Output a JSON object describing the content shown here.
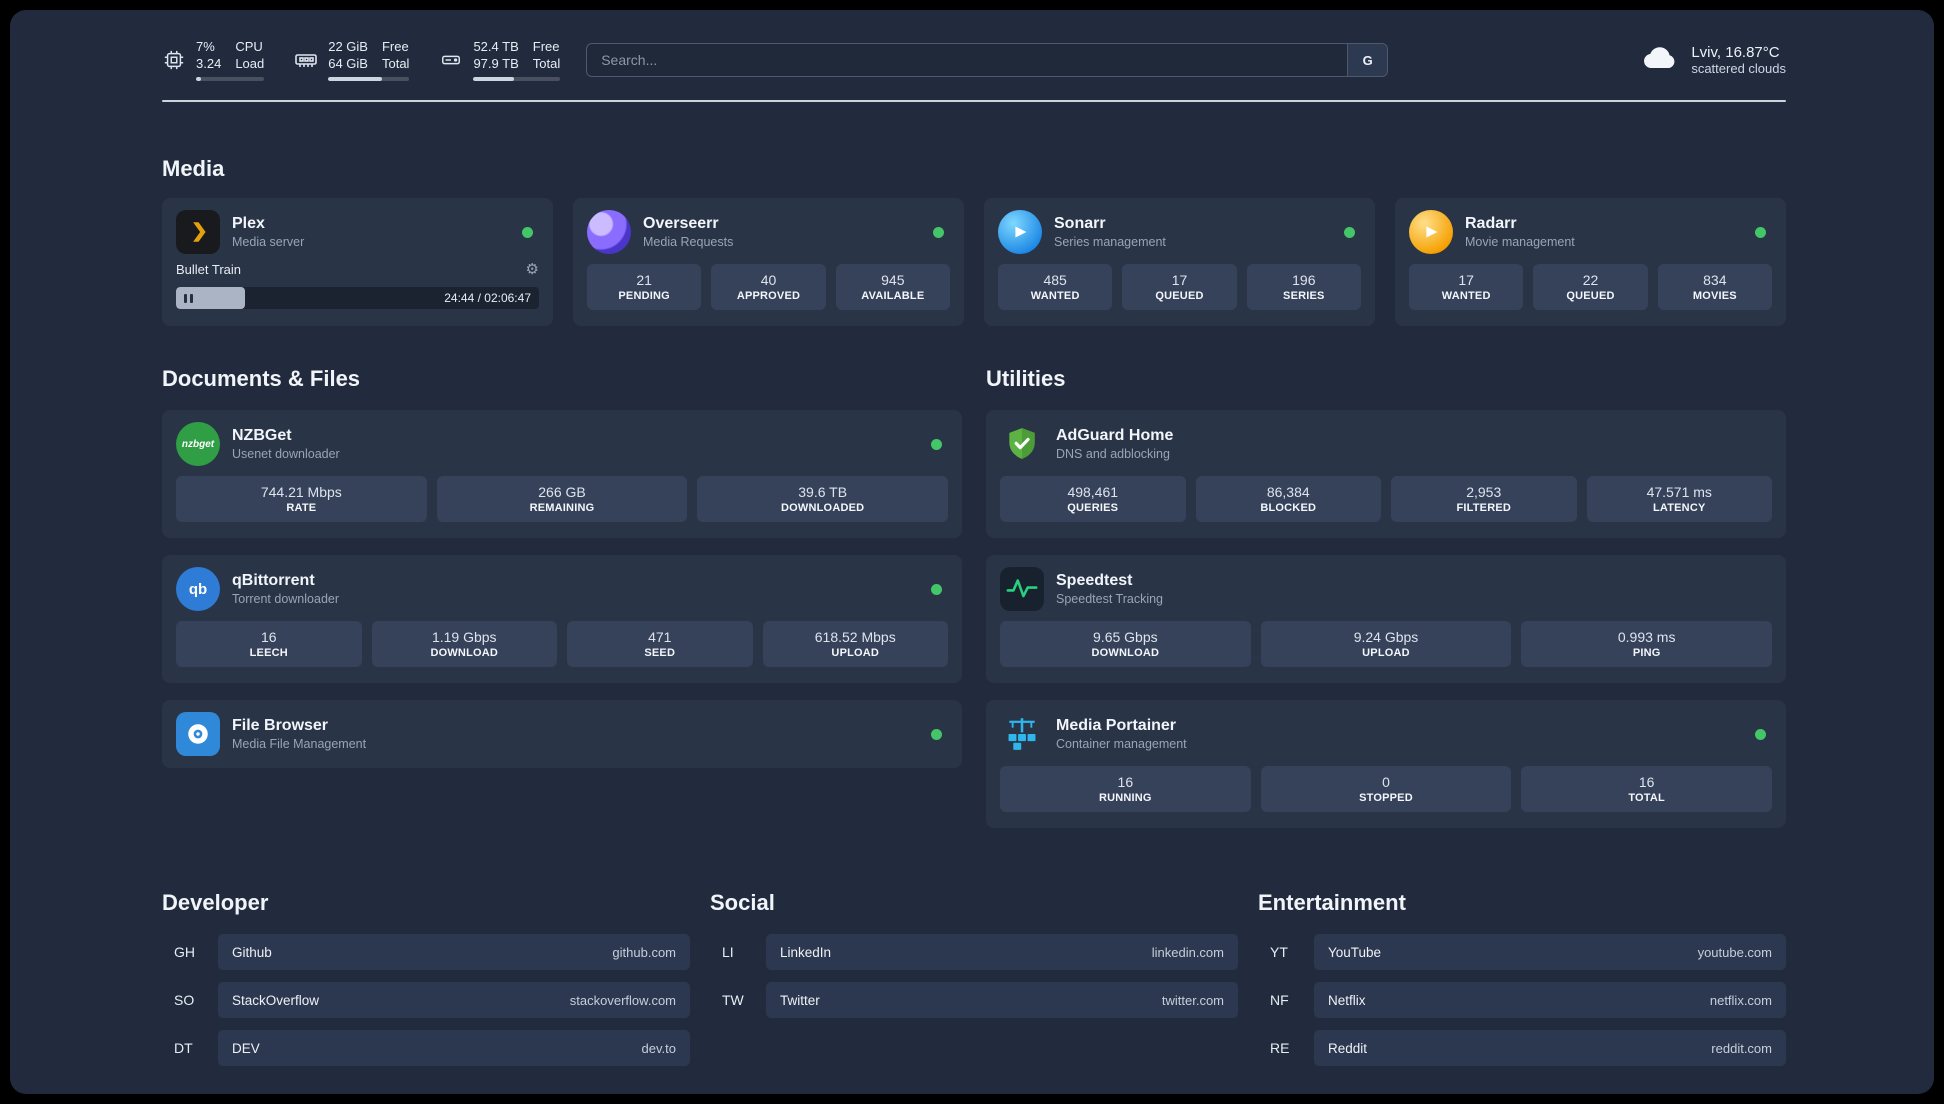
{
  "topbar": {
    "cpu": {
      "percent": "7%",
      "load": "3.24",
      "label_top": "CPU",
      "label_bottom": "Load",
      "fill_percent": 7
    },
    "memory": {
      "free": "22 GiB",
      "total": "64 GiB",
      "label_top": "Free",
      "label_bottom": "Total",
      "fill_percent": 66
    },
    "disk": {
      "free": "52.4 TB",
      "total": "97.9 TB",
      "label_top": "Free",
      "label_bottom": "Total",
      "fill_percent": 47
    },
    "search": {
      "placeholder": "Search...",
      "engine_label": "G"
    },
    "weather": {
      "location_temp": "Lviv, 16.87°C",
      "condition": "scattered clouds"
    }
  },
  "media": {
    "title": "Media",
    "plex": {
      "name": "Plex",
      "subtitle": "Media server",
      "now_playing": "Bullet Train",
      "time": "24:44 / 02:06:47",
      "progress_percent": 19
    },
    "overseerr": {
      "name": "Overseerr",
      "subtitle": "Media Requests",
      "stats": [
        {
          "value": "21",
          "label": "PENDING"
        },
        {
          "value": "40",
          "label": "APPROVED"
        },
        {
          "value": "945",
          "label": "AVAILABLE"
        }
      ]
    },
    "sonarr": {
      "name": "Sonarr",
      "subtitle": "Series management",
      "stats": [
        {
          "value": "485",
          "label": "WANTED"
        },
        {
          "value": "17",
          "label": "QUEUED"
        },
        {
          "value": "196",
          "label": "SERIES"
        }
      ]
    },
    "radarr": {
      "name": "Radarr",
      "subtitle": "Movie management",
      "stats": [
        {
          "value": "17",
          "label": "WANTED"
        },
        {
          "value": "22",
          "label": "QUEUED"
        },
        {
          "value": "834",
          "label": "MOVIES"
        }
      ]
    }
  },
  "documents": {
    "title": "Documents & Files",
    "nzbget": {
      "name": "NZBGet",
      "subtitle": "Usenet downloader",
      "icon_text": "nzbget",
      "stats": [
        {
          "value": "744.21 Mbps",
          "label": "RATE"
        },
        {
          "value": "266 GB",
          "label": "REMAINING"
        },
        {
          "value": "39.6 TB",
          "label": "DOWNLOADED"
        }
      ]
    },
    "qbittorrent": {
      "name": "qBittorrent",
      "subtitle": "Torrent downloader",
      "icon_text": "qb",
      "stats": [
        {
          "value": "16",
          "label": "LEECH"
        },
        {
          "value": "1.19 Gbps",
          "label": "DOWNLOAD"
        },
        {
          "value": "471",
          "label": "SEED"
        },
        {
          "value": "618.52 Mbps",
          "label": "UPLOAD"
        }
      ]
    },
    "filebrowser": {
      "name": "File Browser",
      "subtitle": "Media File Management"
    }
  },
  "utilities": {
    "title": "Utilities",
    "adguard": {
      "name": "AdGuard Home",
      "subtitle": "DNS and adblocking",
      "stats": [
        {
          "value": "498,461",
          "label": "QUERIES"
        },
        {
          "value": "86,384",
          "label": "BLOCKED"
        },
        {
          "value": "2,953",
          "label": "FILTERED"
        },
        {
          "value": "47.571 ms",
          "label": "LATENCY"
        }
      ]
    },
    "speedtest": {
      "name": "Speedtest",
      "subtitle": "Speedtest Tracking",
      "stats": [
        {
          "value": "9.65 Gbps",
          "label": "DOWNLOAD"
        },
        {
          "value": "9.24 Gbps",
          "label": "UPLOAD"
        },
        {
          "value": "0.993 ms",
          "label": "PING"
        }
      ]
    },
    "portainer": {
      "name": "Media Portainer",
      "subtitle": "Container management",
      "stats": [
        {
          "value": "16",
          "label": "RUNNING"
        },
        {
          "value": "0",
          "label": "STOPPED"
        },
        {
          "value": "16",
          "label": "TOTAL"
        }
      ]
    }
  },
  "bookmarks": {
    "developer": {
      "title": "Developer",
      "items": [
        {
          "abbr": "GH",
          "name": "Github",
          "url": "github.com"
        },
        {
          "abbr": "SO",
          "name": "StackOverflow",
          "url": "stackoverflow.com"
        },
        {
          "abbr": "DT",
          "name": "DEV",
          "url": "dev.to"
        }
      ]
    },
    "social": {
      "title": "Social",
      "items": [
        {
          "abbr": "LI",
          "name": "LinkedIn",
          "url": "linkedin.com"
        },
        {
          "abbr": "TW",
          "name": "Twitter",
          "url": "twitter.com"
        }
      ]
    },
    "entertainment": {
      "title": "Entertainment",
      "items": [
        {
          "abbr": "YT",
          "name": "YouTube",
          "url": "youtube.com"
        },
        {
          "abbr": "NF",
          "name": "Netflix",
          "url": "netflix.com"
        },
        {
          "abbr": "RE",
          "name": "Reddit",
          "url": "reddit.com"
        }
      ]
    }
  },
  "colors": {
    "status_online": "#43c667",
    "plex_amber": "#e5a00d",
    "sonarr_blue": "#1e88e5",
    "radarr_yellow": "#f59f00",
    "overseerr_purple": "#8a6cff",
    "nzbget_green": "#2f9e44",
    "qbittorrent_blue": "#2e7cd6",
    "filebrowser_blue": "#2f89d8",
    "adguard_green": "#5cb344",
    "speedtest_green": "#27d17f",
    "portainer_blue": "#2fb7ed"
  }
}
